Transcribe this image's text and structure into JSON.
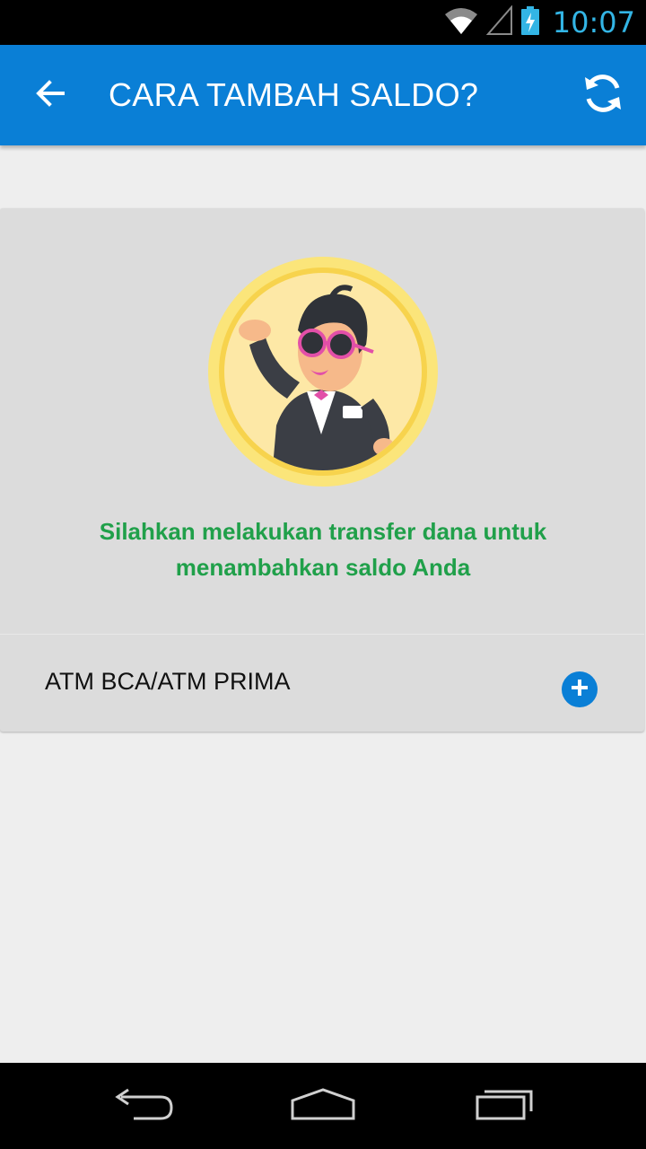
{
  "status_bar": {
    "time": "10:07",
    "time_color": "#33b5e5"
  },
  "app_bar": {
    "title": "CARA TAMBAH SALDO?",
    "background": "#0a7fd6",
    "back_icon": "arrow-back-icon",
    "refresh_icon": "refresh-icon"
  },
  "card": {
    "mascot_icon": "mascot-illustration",
    "message": "Silahkan melakukan transfer dana untuk menambahkan saldo Anda",
    "message_color": "#20a04a",
    "payment_methods": [
      {
        "label": "ATM BCA/ATM PRIMA",
        "icon": "plus-circle-icon"
      }
    ]
  },
  "nav_bar": {
    "back_icon": "nav-back-icon",
    "home_icon": "nav-home-icon",
    "recents_icon": "nav-recents-icon"
  }
}
